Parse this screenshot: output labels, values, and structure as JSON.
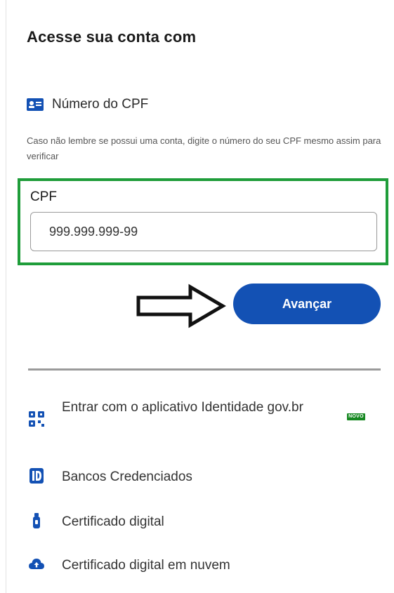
{
  "login": {
    "title": "Acesse sua conta com",
    "cpf_option": {
      "icon": "id-card-icon",
      "label": "Número do CPF"
    },
    "help_text": "Caso não lembre se possui uma conta, digite o número do seu CPF mesmo assim para verificar",
    "cpf_field": {
      "label": "CPF",
      "value": "999.999.999-99"
    },
    "advance_button": "Avançar",
    "other_options": [
      {
        "icon": "qr-code-icon",
        "label": "Entrar com o aplicativo Identidade gov.br",
        "badge": "NOVO"
      },
      {
        "icon": "bank-icon",
        "label": "Bancos Credenciados"
      },
      {
        "icon": "usb-token-icon",
        "label": "Certificado digital"
      },
      {
        "icon": "cloud-icon",
        "label": "Certificado digital em nuvem"
      }
    ]
  },
  "colors": {
    "primary": "#1351b4",
    "highlight_border": "#1f9d3a",
    "badge": "#168821"
  }
}
